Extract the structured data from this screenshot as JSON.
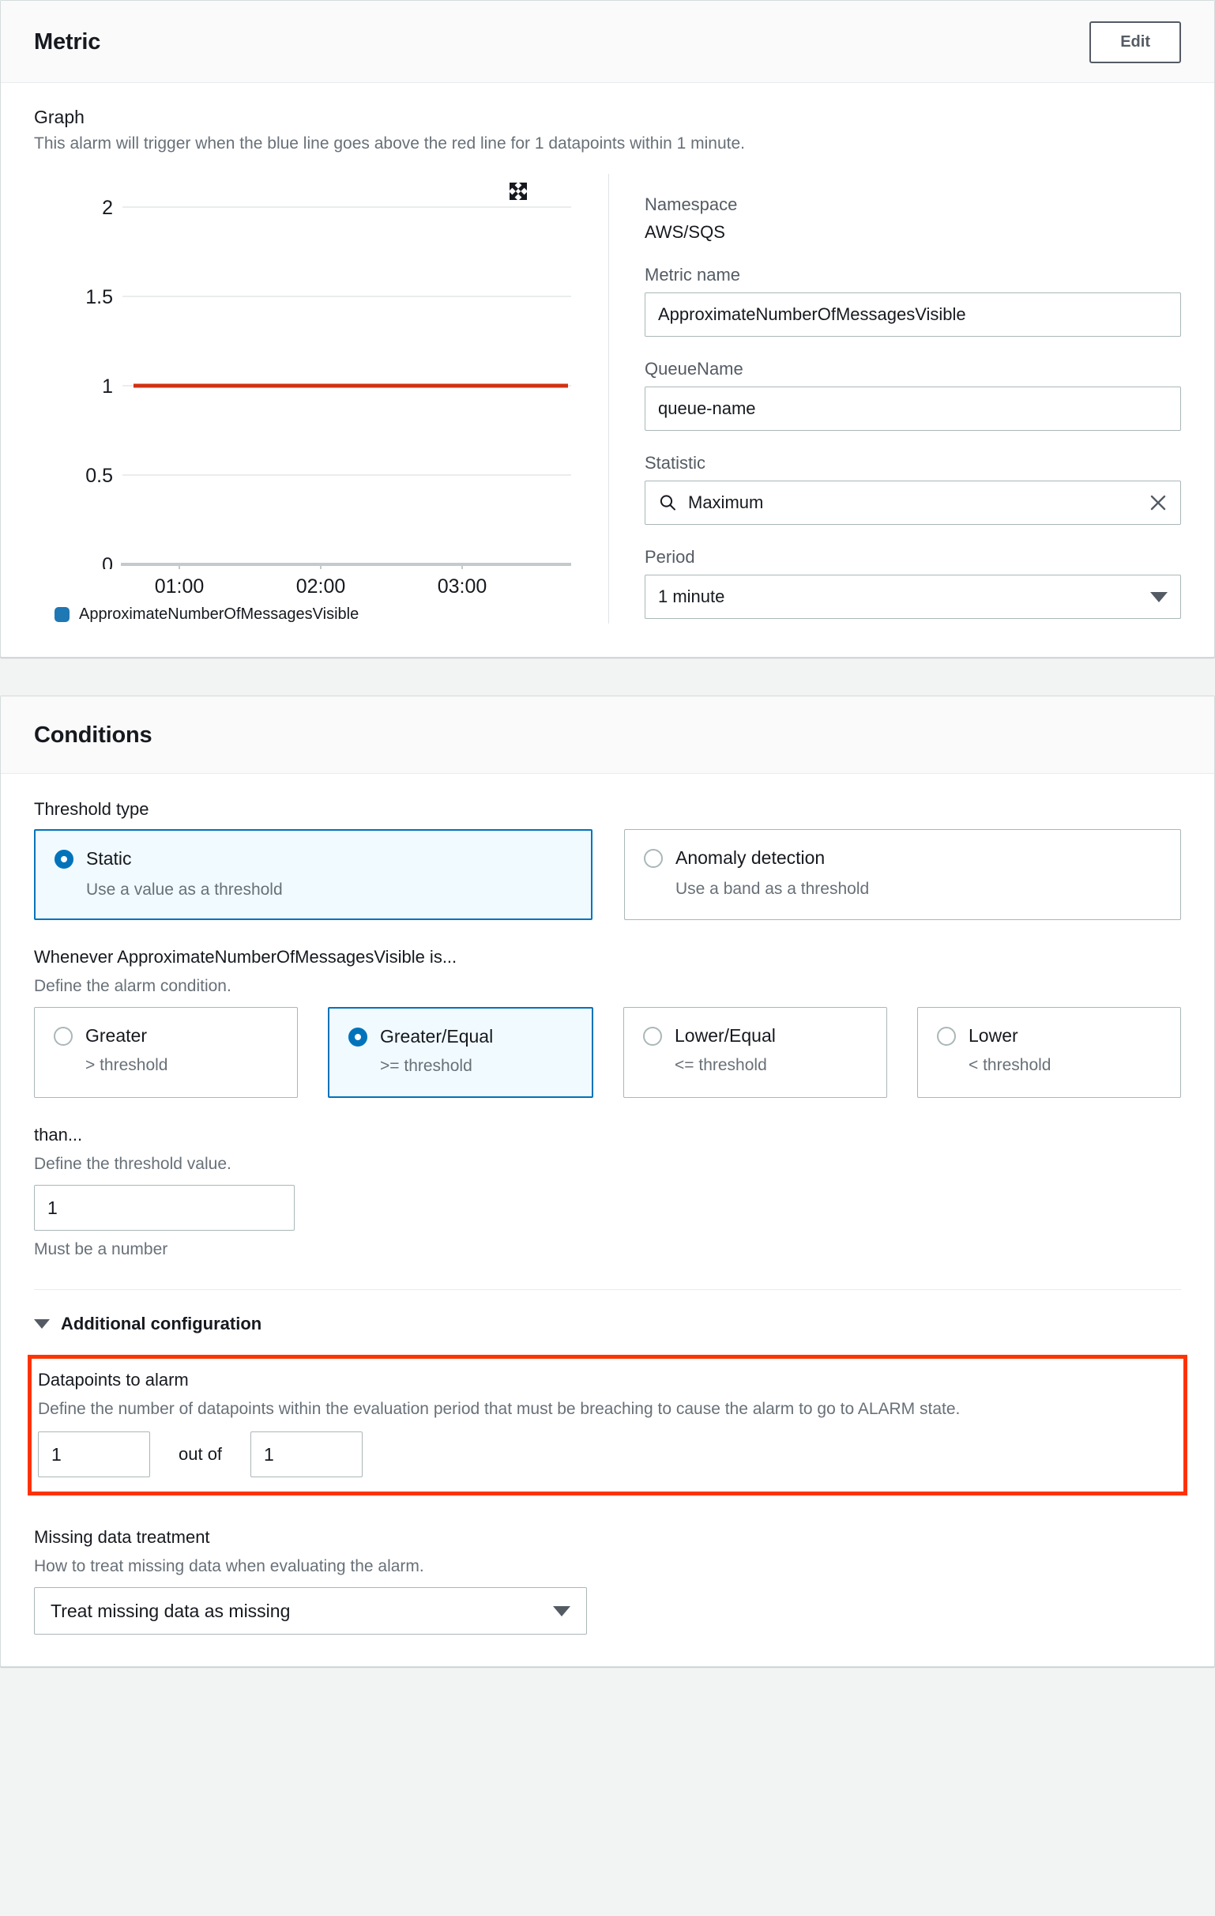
{
  "metric_panel": {
    "title": "Metric",
    "edit_label": "Edit",
    "graph_heading": "Graph",
    "graph_description": "This alarm will trigger when the blue line goes above the red line for 1 datapoints within 1 minute.",
    "expand_icon": "expand-icon",
    "fields": {
      "namespace_label": "Namespace",
      "namespace_value": "AWS/SQS",
      "metric_name_label": "Metric name",
      "metric_name_value": "ApproximateNumberOfMessagesVisible",
      "queue_name_label": "QueueName",
      "queue_name_value": "queue-name",
      "statistic_label": "Statistic",
      "statistic_value": "Maximum",
      "statistic_search_icon": "search-icon",
      "statistic_clear_icon": "close-icon",
      "period_label": "Period",
      "period_value": "1 minute"
    }
  },
  "chart_data": {
    "type": "line",
    "title": "",
    "xlabel": "",
    "ylabel": "",
    "x_tick_labels": [
      "01:00",
      "02:00",
      "03:00"
    ],
    "y_tick_labels": [
      "0",
      "0.5",
      "1",
      "1.5",
      "2"
    ],
    "ylim": [
      0,
      2
    ],
    "yticks": [
      0,
      0.5,
      1,
      1.5,
      2
    ],
    "grid": true,
    "legend_position": "bottom-left",
    "series": [
      {
        "name": "ApproximateNumberOfMessagesVisible",
        "color": "#1f77b4",
        "type": "line",
        "values": []
      },
      {
        "name": "threshold",
        "color": "#d13212",
        "type": "hline",
        "value": 1
      }
    ]
  },
  "conditions_panel": {
    "title": "Conditions",
    "threshold_type": {
      "label": "Threshold type",
      "options": [
        {
          "label": "Static",
          "desc": "Use a value as a threshold",
          "selected": true
        },
        {
          "label": "Anomaly detection",
          "desc": "Use a band as a threshold",
          "selected": false
        }
      ]
    },
    "whenever": {
      "label": "Whenever ApproximateNumberOfMessagesVisible is...",
      "desc": "Define the alarm condition.",
      "options": [
        {
          "label": "Greater",
          "desc": "> threshold",
          "selected": false
        },
        {
          "label": "Greater/Equal",
          "desc": ">= threshold",
          "selected": true
        },
        {
          "label": "Lower/Equal",
          "desc": "<= threshold",
          "selected": false
        },
        {
          "label": "Lower",
          "desc": "< threshold",
          "selected": false
        }
      ]
    },
    "than": {
      "label": "than...",
      "desc": "Define the threshold value.",
      "value": "1",
      "hint": "Must be a number"
    },
    "additional_configuration": {
      "toggle_label": "Additional configuration",
      "toggle_icon": "chevron-down-icon",
      "datapoints": {
        "label": "Datapoints to alarm",
        "desc": "Define the number of datapoints within the evaluation period that must be breaching to cause the alarm to go to ALARM state.",
        "value_a": "1",
        "mid_label": "out of",
        "value_b": "1",
        "highlight_color": "#ff3300"
      },
      "missing_data": {
        "label": "Missing data treatment",
        "desc": "How to treat missing data when evaluating the alarm.",
        "value": "Treat missing data as missing",
        "caret_icon": "chevron-down-icon"
      }
    }
  }
}
